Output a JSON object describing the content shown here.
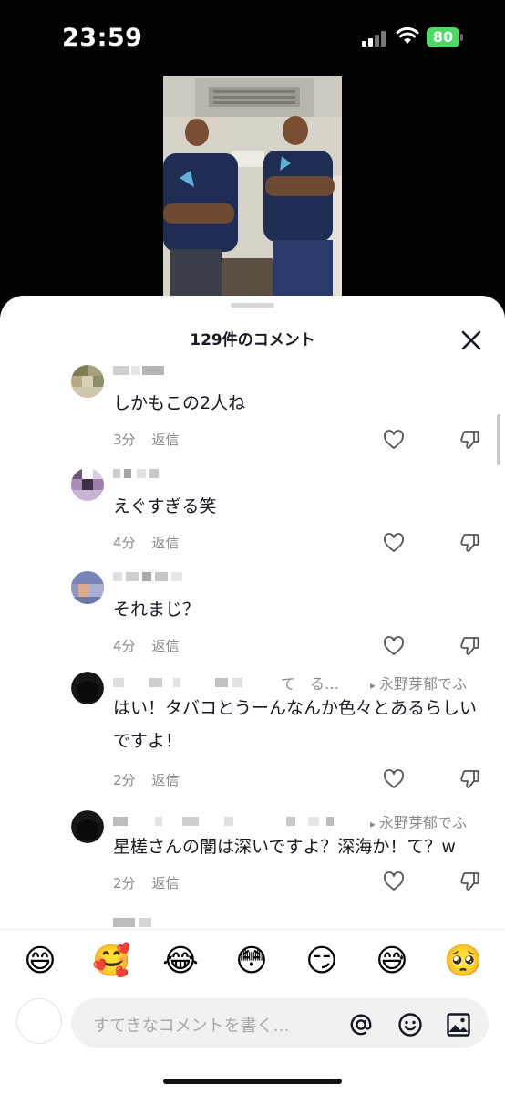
{
  "status_bar": {
    "time": "23:59",
    "battery": "80"
  },
  "sheet": {
    "title": "129件のコメント"
  },
  "comments": [
    {
      "text": "しかもこの2人ね",
      "time": "3分",
      "reply_label": "返信"
    },
    {
      "text": "えぐすぎる笑",
      "time": "4分",
      "reply_label": "返信"
    },
    {
      "text": "それまじ？",
      "time": "4分",
      "reply_label": "返信"
    },
    {
      "mid_text": "て　る…",
      "reply_to": "永野芽郁でふ",
      "text": "はい！タバコとうーんなんか色々とあるらしいですよ！",
      "time": "2分",
      "reply_label": "返信"
    },
    {
      "reply_to": "永野芽郁でふ",
      "text": "星槎さんの闇は深いですよ？深海か！て？w",
      "time": "2分",
      "reply_label": "返信"
    }
  ],
  "emoji_bar": [
    "😄",
    "🥰",
    "😂",
    "😳",
    "😏",
    "😅",
    "🥺"
  ],
  "input": {
    "placeholder": "すてきなコメントを書く…"
  },
  "icons": [
    "close-icon",
    "heart-icon",
    "thumbs-down-icon",
    "at-icon",
    "smile-icon",
    "image-icon",
    "signal-icon",
    "wifi-icon",
    "battery-icon"
  ]
}
